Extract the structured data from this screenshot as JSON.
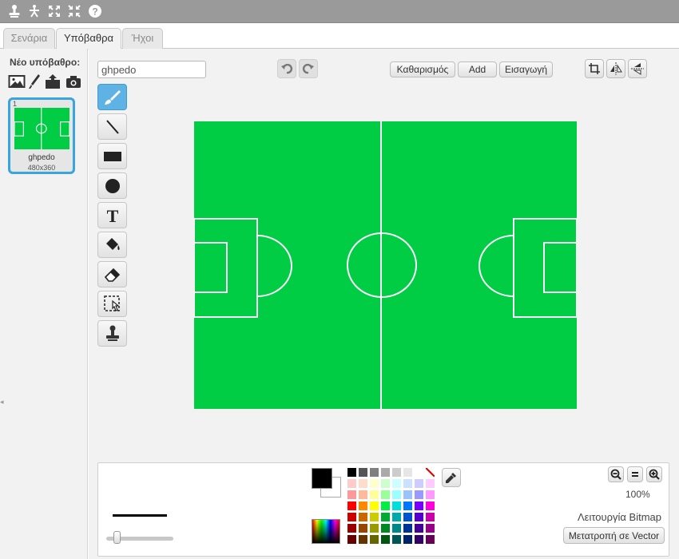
{
  "top_toolbar": {
    "icons": [
      "stamp-icon",
      "cut-icon",
      "grow-icon",
      "shrink-icon",
      "help-icon"
    ]
  },
  "tabs": [
    {
      "label": "Σενάρια",
      "active": false
    },
    {
      "label": "Υπόβαθρα",
      "active": true
    },
    {
      "label": "Ήχοι",
      "active": false
    }
  ],
  "sidebar": {
    "new_backdrop_label": "Νέο υπόβαθρο:",
    "new_backdrop_icons": [
      "library-image-icon",
      "paint-brush-icon",
      "upload-icon",
      "camera-icon"
    ],
    "backdrops": [
      {
        "number": "1",
        "name": "ghpedo",
        "size": "480x360",
        "selected": true
      }
    ]
  },
  "editor": {
    "costume_name_value": "ghpedo",
    "clear_label": "Καθαρισμός",
    "add_label": "Add",
    "import_label": "Εισαγωγή",
    "tools": [
      "brush",
      "line",
      "rectangle",
      "ellipse",
      "text",
      "fill",
      "eraser",
      "select",
      "stamp"
    ],
    "active_tool": "brush",
    "canvas": {
      "field_color": "#00cc44",
      "line_color": "#ffffff"
    },
    "zoom_label": "100%",
    "mode_label": "Λειτουργία Bitmap",
    "convert_label": "Μετατροπή σε Vector",
    "foreground_color": "#000000",
    "background_color": "#ffffff",
    "palette": [
      [
        "#000000",
        "#555555",
        "#7f7f7f",
        "#aaaaaa",
        "#cccccc",
        "#e6e6e6",
        "#ffffff",
        "none"
      ],
      [
        "#ffcccc",
        "#ffddcc",
        "#ffffcc",
        "#ccffcc",
        "#ccffff",
        "#cce0ff",
        "#ccccff",
        "#ffccff"
      ],
      [
        "#ff9999",
        "#ffbb99",
        "#ffff99",
        "#99ff99",
        "#99ffff",
        "#99c2ff",
        "#9999ff",
        "#ff99ff"
      ],
      [
        "#ff0000",
        "#ff8800",
        "#ffff00",
        "#00ee44",
        "#00dddd",
        "#0077ff",
        "#7700ff",
        "#ff00dd"
      ],
      [
        "#cc0000",
        "#cc6600",
        "#cccc00",
        "#00aa33",
        "#00aaaa",
        "#0055cc",
        "#5500cc",
        "#cc00aa"
      ],
      [
        "#990000",
        "#994400",
        "#999900",
        "#008822",
        "#008888",
        "#003399",
        "#440099",
        "#990088"
      ],
      [
        "#660000",
        "#663300",
        "#666600",
        "#005511",
        "#005555",
        "#002266",
        "#330066",
        "#660055"
      ]
    ]
  }
}
